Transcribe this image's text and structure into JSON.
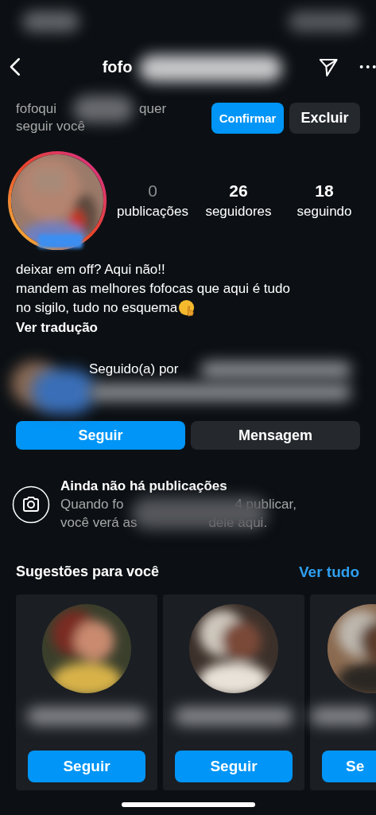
{
  "header": {
    "title": "fofo"
  },
  "request": {
    "parts": [
      "fofoqui",
      "quer",
      "seguir você"
    ],
    "buttons": [
      {
        "label": "Confirmar",
        "kind": "primary"
      },
      {
        "label": "Excluir",
        "kind": "secondary"
      }
    ]
  },
  "stats": [
    {
      "value": "0",
      "label": "publicações",
      "disabled": true
    },
    {
      "value": "26",
      "label": "seguidores",
      "disabled": false
    },
    {
      "value": "18",
      "label": "seguindo",
      "disabled": false
    }
  ],
  "bio": {
    "lines": [
      "deixar em off? Aqui não!!",
      "mandem as melhores fofocas que aqui é tudo",
      "no sigilo, tudo no esquema"
    ],
    "translate": "Ver tradução"
  },
  "followed_by": {
    "text": "Seguido(a) por"
  },
  "actions": [
    {
      "label": "Seguir",
      "kind": "primary"
    },
    {
      "label": "Mensagem",
      "kind": "secondary"
    }
  ],
  "empty": {
    "title": "Ainda não há publicações",
    "line1": [
      "Quando fo",
      "4 publicar,"
    ],
    "line2": [
      "você verá as",
      "dele aqui."
    ]
  },
  "suggestions": {
    "title": "Sugestões para você",
    "link": "Ver tudo",
    "cards": [
      {
        "kind": "picture",
        "button": "Seguir"
      },
      {
        "kind": "picture",
        "button": "Seguir"
      },
      {
        "kind": "picture",
        "button": "Se"
      }
    ]
  }
}
